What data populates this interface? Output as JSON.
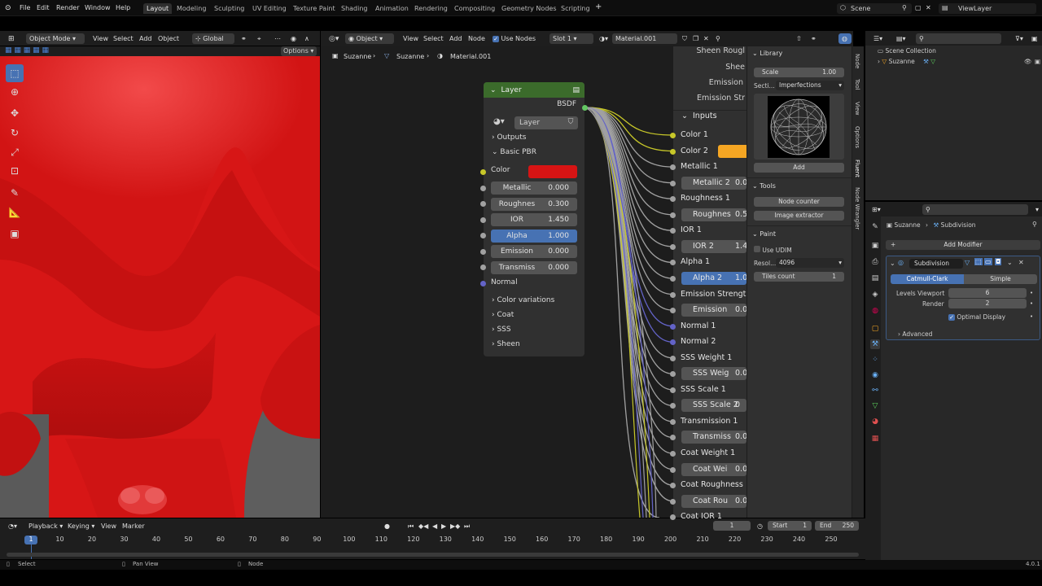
{
  "menu": [
    "File",
    "Edit",
    "Render",
    "Window",
    "Help"
  ],
  "workspaces": [
    "Layout",
    "Modeling",
    "Sculpting",
    "UV Editing",
    "Texture Paint",
    "Shading",
    "Animation",
    "Rendering",
    "Compositing",
    "Geometry Nodes",
    "Scripting"
  ],
  "active_workspace": "Layout",
  "scene": "Scene",
  "view_layer": "ViewLayer",
  "viewport_header": {
    "mode": "Object Mode",
    "menus": [
      "View",
      "Select",
      "Add",
      "Object"
    ],
    "orientation": "Global",
    "options": "Options"
  },
  "node_header": {
    "type": "Object",
    "menus": [
      "View",
      "Select",
      "Add",
      "Node"
    ],
    "use_nodes": "Use Nodes",
    "slot": "Slot 1",
    "material": "Material.001"
  },
  "breadcrumb": [
    "Suzanne",
    "Suzanne",
    "Material.001"
  ],
  "layer_node": {
    "title": "Layer",
    "output": "BSDF",
    "layer_select": "Layer",
    "outputs": "Outputs",
    "basic_pbr": "Basic PBR",
    "color_label": "Color",
    "color_value": "#d71414",
    "fields": [
      {
        "label": "Metallic",
        "value": "0.000"
      },
      {
        "label": "Roughnes",
        "value": "0.300"
      },
      {
        "label": "IOR",
        "value": "1.450"
      },
      {
        "label": "Alpha",
        "value": "1.000"
      },
      {
        "label": "Emission",
        "value": "0.000"
      },
      {
        "label": "Transmiss",
        "value": "0.000"
      }
    ],
    "normal": "Normal",
    "collapsed": [
      "Color variations",
      "Coat",
      "SSS",
      "Sheen"
    ]
  },
  "group_node": {
    "top": [
      "Sheen Rougl",
      "Shee",
      "Emission",
      "Emission Str"
    ],
    "inputs_label": "Inputs",
    "rows": [
      {
        "t": "plain",
        "label": "Color 1",
        "sock": "yel"
      },
      {
        "t": "color",
        "label": "Color 2",
        "sock": "yel",
        "color": "#f5a623"
      },
      {
        "t": "plain",
        "label": "Metallic 1",
        "sock": "grey"
      },
      {
        "t": "field",
        "label": "Metallic 2",
        "val": "0.0"
      },
      {
        "t": "plain",
        "label": "Roughness 1",
        "sock": "grey"
      },
      {
        "t": "field",
        "label": "Roughnes",
        "val": "0.5"
      },
      {
        "t": "plain",
        "label": "IOR 1",
        "sock": "grey"
      },
      {
        "t": "field",
        "label": "IOR 2",
        "val": "1.4"
      },
      {
        "t": "plain",
        "label": "Alpha 1",
        "sock": "grey"
      },
      {
        "t": "sel",
        "label": "Alpha 2",
        "val": "1.0"
      },
      {
        "t": "plain",
        "label": "Emission Strengt",
        "sock": "grey"
      },
      {
        "t": "field",
        "label": "Emission",
        "val": "0.0"
      },
      {
        "t": "plain",
        "label": "Normal 1",
        "sock": "pur"
      },
      {
        "t": "plain",
        "label": "Normal 2",
        "sock": "pur"
      },
      {
        "t": "plain",
        "label": "SSS Weight 1",
        "sock": "grey"
      },
      {
        "t": "field",
        "label": "SSS Weig",
        "val": "0.0"
      },
      {
        "t": "plain",
        "label": "SSS Scale 1",
        "sock": "grey"
      },
      {
        "t": "field",
        "label": "SSS Scale 2",
        "val": "0"
      },
      {
        "t": "plain",
        "label": "Transmission 1",
        "sock": "grey"
      },
      {
        "t": "field",
        "label": "Transmiss",
        "val": "0.0"
      },
      {
        "t": "plain",
        "label": "Coat Weight 1",
        "sock": "grey"
      },
      {
        "t": "field",
        "label": "Coat Wei",
        "val": "0.0"
      },
      {
        "t": "plain",
        "label": "Coat Roughness",
        "sock": "grey"
      },
      {
        "t": "field",
        "label": "Coat Rou",
        "val": "0.0"
      },
      {
        "t": "plain",
        "label": "Coat IOR 1",
        "sock": "grey"
      }
    ]
  },
  "sidebar": {
    "library": "Library",
    "scale_label": "Scale",
    "scale_value": "1.00",
    "section_label": "Secti...",
    "section_value": "Imperfections",
    "add": "Add",
    "tools": "Tools",
    "node_counter": "Node counter",
    "image_extractor": "Image extractor",
    "paint": "Paint",
    "use_udim": "Use UDIM",
    "resol_label": "Resol...",
    "resol_value": "4096",
    "tiles_label": "Tiles count",
    "tiles_value": "1",
    "tabs": [
      "Node",
      "Tool",
      "View",
      "Options",
      "Fluent",
      "Node Wrangler"
    ]
  },
  "outliner": {
    "collection": "Scene Collection",
    "object": "Suzanne"
  },
  "properties": {
    "object": "Suzanne",
    "modifier_crumb": "Subdivision",
    "add_modifier": "Add Modifier",
    "modifier_name": "Subdivision",
    "catmull": "Catmull-Clark",
    "simple": "Simple",
    "levels_viewport_label": "Levels Viewport",
    "levels_viewport": "6",
    "render_label": "Render",
    "render": "2",
    "optimal": "Optimal Display",
    "advanced": "Advanced"
  },
  "timeline": {
    "menus": [
      "Playback",
      "Keying",
      "View",
      "Marker"
    ],
    "current": "1",
    "start_label": "Start",
    "start": "1",
    "end_label": "End",
    "end": "250",
    "ticks": [
      "1",
      "10",
      "20",
      "30",
      "40",
      "50",
      "60",
      "70",
      "80",
      "90",
      "100",
      "110",
      "120",
      "130",
      "140",
      "150",
      "160",
      "170",
      "180",
      "190",
      "200",
      "210",
      "220",
      "230",
      "240",
      "250"
    ]
  },
  "status": {
    "select": "Select",
    "pan": "Pan View",
    "node": "Node",
    "version": "4.0.1"
  }
}
